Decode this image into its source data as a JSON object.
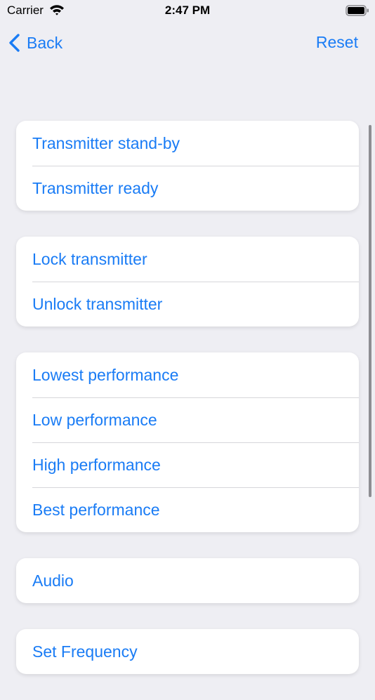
{
  "status_bar": {
    "carrier": "Carrier",
    "time": "2:47 PM"
  },
  "nav": {
    "back_label": "Back",
    "reset_label": "Reset"
  },
  "groups": [
    {
      "items": [
        "Transmitter stand-by",
        "Transmitter ready"
      ]
    },
    {
      "items": [
        "Lock transmitter",
        "Unlock transmitter"
      ]
    },
    {
      "items": [
        "Lowest performance",
        "Low performance",
        "High performance",
        "Best performance"
      ]
    },
    {
      "items": [
        "Audio"
      ]
    },
    {
      "items": [
        "Set Frequency"
      ]
    }
  ],
  "icons": {
    "wifi": "wifi-icon",
    "battery": "battery-icon",
    "back": "chevron-left-icon"
  },
  "colors": {
    "accent": "#1A7CF5",
    "background": "#EEEEF3",
    "card": "#FFFFFF",
    "separator": "#D6D6DA"
  }
}
